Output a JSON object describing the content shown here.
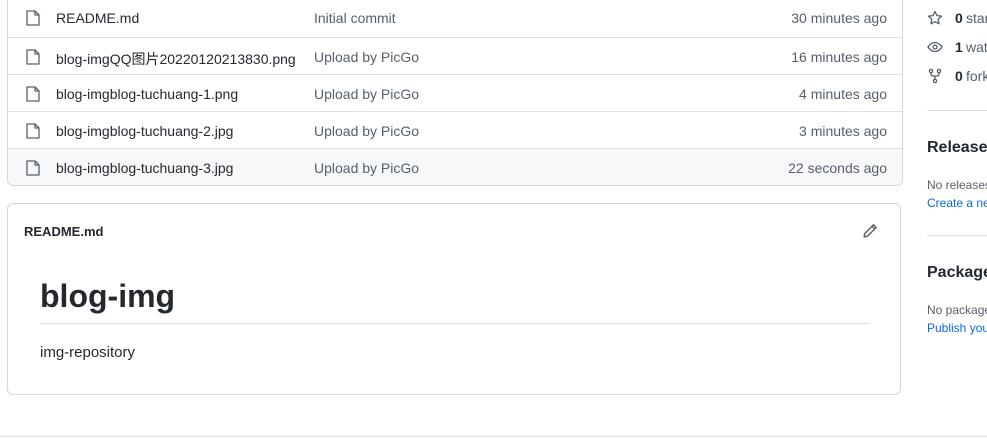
{
  "files": [
    {
      "name": "README.md",
      "message": "Initial commit",
      "age": "30 minutes ago"
    },
    {
      "name": "blog-imgQQ图片20220120213830.png",
      "message": "Upload by PicGo",
      "age": "16 minutes ago"
    },
    {
      "name": "blog-imgblog-tuchuang-1.png",
      "message": "Upload by PicGo",
      "age": "4 minutes ago"
    },
    {
      "name": "blog-imgblog-tuchuang-2.jpg",
      "message": "Upload by PicGo",
      "age": "3 minutes ago"
    },
    {
      "name": "blog-imgblog-tuchuang-3.jpg",
      "message": "Upload by PicGo",
      "age": "22 seconds ago"
    }
  ],
  "readme": {
    "file_title": "README.md",
    "heading": "blog-img",
    "description": "img-repository"
  },
  "sidebar": {
    "stars": {
      "count": "0",
      "label": "stars"
    },
    "watching": {
      "count": "1",
      "label": "watching"
    },
    "forks": {
      "count": "0",
      "label": "forks"
    },
    "releases": {
      "title": "Releases",
      "note": "No releases published",
      "link": "Create a new release"
    },
    "packages": {
      "title": "Packages",
      "note": "No packages published",
      "link": "Publish your first package"
    }
  },
  "colors": {
    "link": "#0969da",
    "muted": "#57606a",
    "border": "#d0d7de"
  }
}
